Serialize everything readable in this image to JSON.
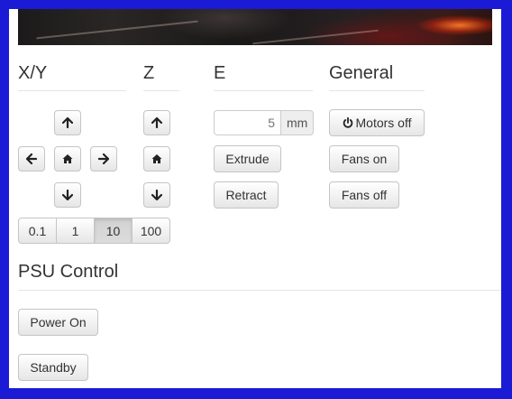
{
  "xy": {
    "title": "X/Y",
    "step_options": [
      "0.1",
      "1",
      "10",
      "100"
    ],
    "selected_step": "10"
  },
  "z": {
    "title": "Z"
  },
  "e": {
    "title": "E",
    "amount_value": "5",
    "amount_unit": "mm",
    "extrude_label": "Extrude",
    "retract_label": "Retract"
  },
  "general": {
    "title": "General",
    "motors_off_label": "Motors off",
    "fans_on_label": "Fans on",
    "fans_off_label": "Fans off"
  },
  "psu": {
    "title": "PSU Control",
    "power_on_label": "Power On",
    "standby_label": "Standby"
  },
  "icons": {
    "up": "arrow-up-icon",
    "down": "arrow-down-icon",
    "left": "arrow-left-icon",
    "right": "arrow-right-icon",
    "home": "home-icon",
    "power": "power-icon"
  },
  "colors": {
    "frame_border": "#1b1bd6"
  }
}
